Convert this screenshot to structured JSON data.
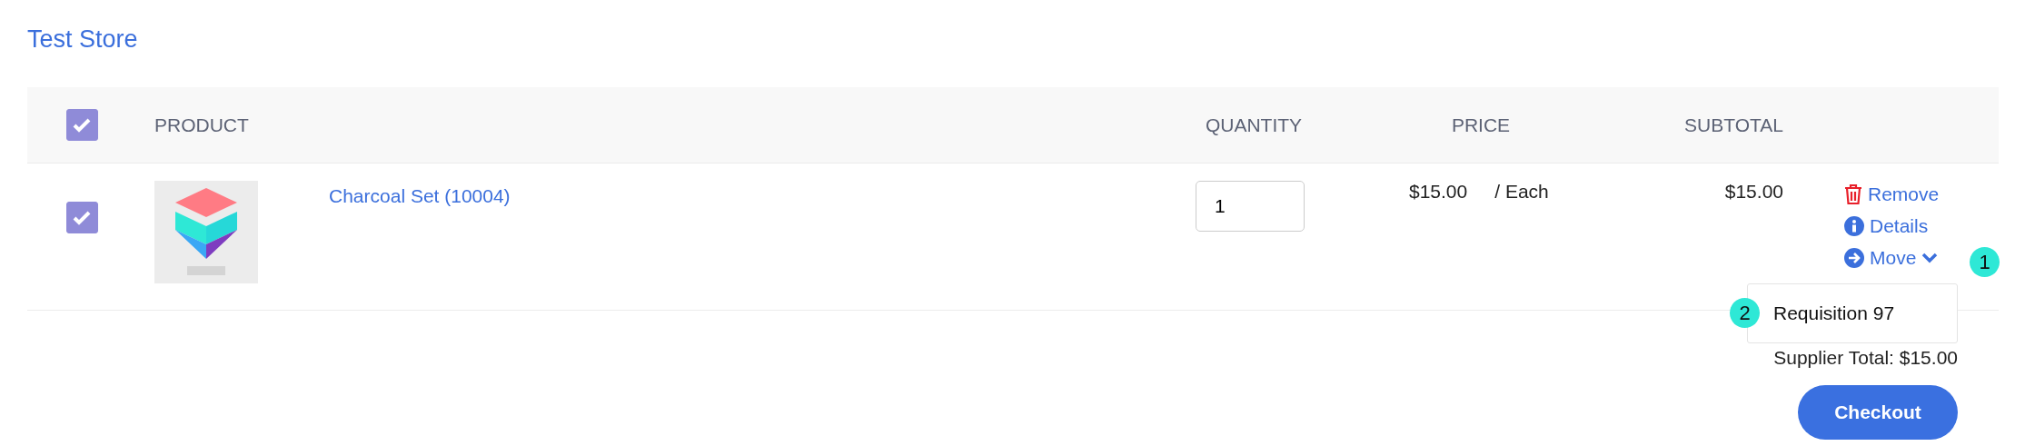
{
  "store": {
    "title": "Test Store"
  },
  "table": {
    "select_all": {
      "checked": true
    },
    "columns": [
      "PRODUCT",
      "QUANTITY",
      "PRICE",
      "SUBTOTAL"
    ],
    "rows": [
      {
        "checked": true,
        "image": {
          "kind": "picture"
        },
        "product": "Charcoal Set (10004)",
        "quantity": "1",
        "price": "$15.00",
        "unit": "/ Each",
        "subtotal": "$15.00",
        "actions": [
          {
            "kind": "remove",
            "label": "Remove"
          },
          {
            "kind": "details",
            "label": "Details"
          },
          {
            "kind": "move",
            "label": "Move",
            "expanded": true,
            "marker": "1"
          }
        ]
      }
    ]
  },
  "move_menu": {
    "marker": "2",
    "items": [
      "Requisition 97"
    ]
  },
  "supplier_total": "Supplier Total: $15.00",
  "checkout": "Checkout"
}
